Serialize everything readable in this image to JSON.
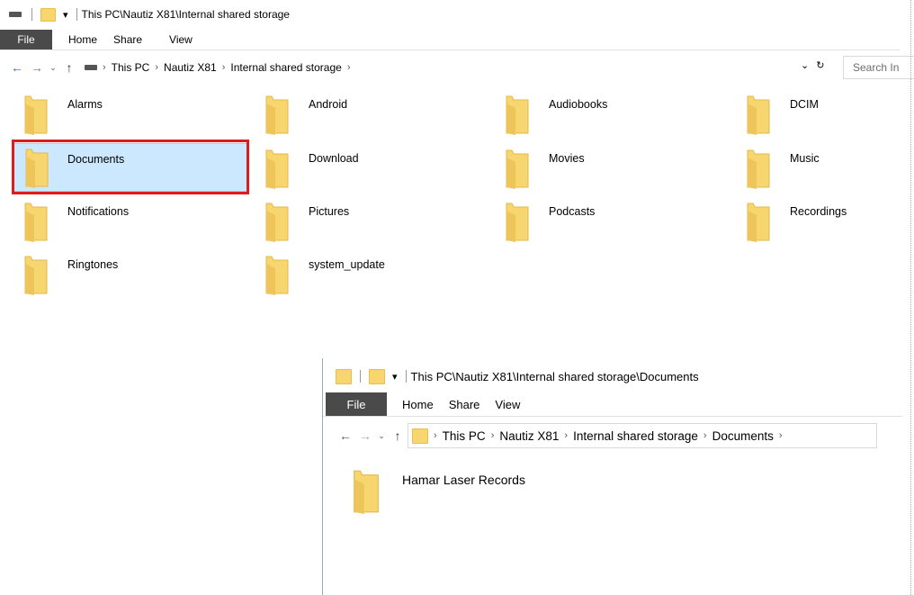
{
  "window1": {
    "title": "This PC\\Nautiz X81\\Internal shared storage",
    "ribbon": {
      "file": "File",
      "tabs": [
        "Home",
        "Share",
        "View"
      ]
    },
    "address": {
      "crumbs": [
        "This PC",
        "Nautiz X81",
        "Internal shared storage"
      ],
      "search_placeholder": "Search In"
    },
    "folders": [
      "Alarms",
      "Android",
      "Audiobooks",
      "DCIM",
      "Documents",
      "Download",
      "Movies",
      "Music",
      "Notifications",
      "Pictures",
      "Podcasts",
      "Recordings",
      "Ringtones",
      "system_update"
    ],
    "selected_folder": "Documents"
  },
  "window2": {
    "title": "This PC\\Nautiz X81\\Internal shared storage\\Documents",
    "ribbon": {
      "file": "File",
      "tabs": [
        "Home",
        "Share",
        "View"
      ]
    },
    "address": {
      "crumbs": [
        "This PC",
        "Nautiz X81",
        "Internal shared storage",
        "Documents"
      ]
    },
    "folders": [
      "Hamar Laser Records"
    ]
  },
  "colors": {
    "folder": "#f7d56f",
    "selection": "#cce8ff",
    "highlight_box": "#e01b1b",
    "nav_arrow": "#1a6fd0"
  }
}
